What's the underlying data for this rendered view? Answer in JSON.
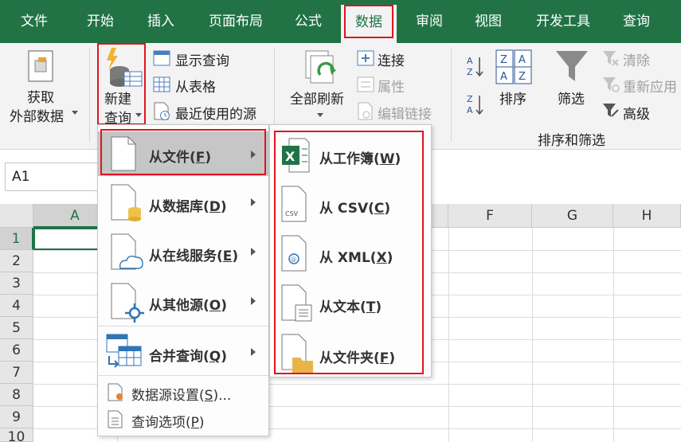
{
  "tabs": [
    "文件",
    "开始",
    "插入",
    "页面布局",
    "公式",
    "数据",
    "审阅",
    "视图",
    "开发工具",
    "查询"
  ],
  "active_tab": "数据",
  "ribbon": {
    "get_external": {
      "line1": "获取",
      "line2": "外部数据"
    },
    "new_query": {
      "line1": "新建",
      "line2": "查询"
    },
    "show_queries": "显示查询",
    "from_table": "从表格",
    "recent_sources": "最近使用的源",
    "refresh_all": "全部刷新",
    "connections": "连接",
    "properties": "属性",
    "edit_links": "编辑链接",
    "sort": "排序",
    "filter": "筛选",
    "clear": "清除",
    "reapply": "重新应用",
    "advanced": "高级",
    "group_sort_filter": "排序和筛选"
  },
  "namebox": "A1",
  "columns": [
    "A",
    "F",
    "G",
    "H"
  ],
  "rows": [
    "1",
    "2",
    "3",
    "4",
    "5",
    "6",
    "7",
    "8",
    "9",
    "10"
  ],
  "menu1": {
    "items": [
      {
        "label": "从文件",
        "key": "F"
      },
      {
        "label": "从数据库",
        "key": "D"
      },
      {
        "label": "从在线服务",
        "key": "E"
      },
      {
        "label": "从其他源",
        "key": "O"
      },
      {
        "label": "合并查询",
        "key": "Q"
      }
    ],
    "footer": [
      {
        "label": "数据源设置",
        "key": "S",
        "suffix": "..."
      },
      {
        "label": "查询选项",
        "key": "P",
        "suffix": ""
      }
    ]
  },
  "menu2": {
    "items": [
      {
        "label": "从工作簿",
        "key": "W"
      },
      {
        "label": "从 CSV",
        "key": "C"
      },
      {
        "label": "从 XML",
        "key": "X"
      },
      {
        "label": "从文本",
        "key": "T"
      },
      {
        "label": "从文件夹",
        "key": "F"
      }
    ]
  },
  "colors": {
    "excel_green": "#217346",
    "highlight_red": "#e0141e",
    "menu_highlight": "#c6c6c6"
  }
}
